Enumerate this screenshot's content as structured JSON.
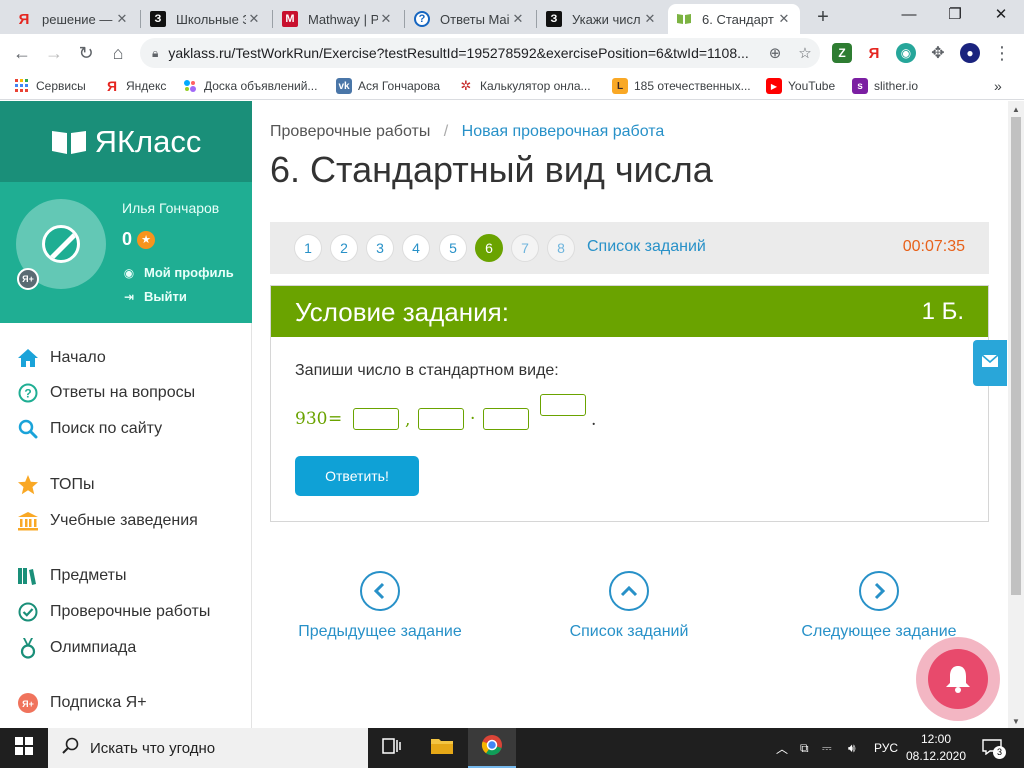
{
  "browser": {
    "tabs": [
      {
        "label": "решение —",
        "favicon": "yandex-icon",
        "active": false
      },
      {
        "label": "Школьные З",
        "favicon": "znanija-icon",
        "active": false
      },
      {
        "label": "Mathway | Pr",
        "favicon": "mathway-icon",
        "active": false
      },
      {
        "label": "Ответы Mail",
        "favicon": "question-icon",
        "active": false
      },
      {
        "label": "Укажи числ",
        "favicon": "znanija-icon",
        "active": false
      },
      {
        "label": "6. Стандарт",
        "favicon": "yaklass-icon",
        "active": true
      }
    ],
    "url": "yaklass.ru/TestWorkRun/Exercise?testResultId=195278592&exercisePosition=6&twId=1108...",
    "bookmarks": [
      {
        "label": "Сервисы",
        "icon": "apps-icon"
      },
      {
        "label": "Яндекс",
        "icon": "yandex-icon"
      },
      {
        "label": "Доска объявлений...",
        "icon": "avito-icon"
      },
      {
        "label": "Ася Гончарова",
        "icon": "vk-icon"
      },
      {
        "label": "Калькулятор онла...",
        "icon": "calculator-icon"
      },
      {
        "label": "185 отечественных...",
        "icon": "lit-icon"
      },
      {
        "label": "YouTube",
        "icon": "youtube-icon"
      },
      {
        "label": "slither.io",
        "icon": "slither-icon"
      }
    ],
    "bookmarks_more": "»"
  },
  "sidebar": {
    "logo": "ЯКласс",
    "user": {
      "name": "Илья Гончаров",
      "points": "0",
      "profile_link": "Мой профиль",
      "logout_link": "Выйти",
      "badge": "Я+"
    },
    "menu": [
      {
        "label": "Начало",
        "icon": "home-icon"
      },
      {
        "label": "Ответы на вопросы",
        "icon": "question-circle-icon"
      },
      {
        "label": "Поиск по сайту",
        "icon": "search-icon"
      },
      {
        "label": "ТОПы",
        "icon": "star-icon"
      },
      {
        "label": "Учебные заведения",
        "icon": "institution-icon"
      },
      {
        "label": "Предметы",
        "icon": "books-icon"
      },
      {
        "label": "Проверочные работы",
        "icon": "check-circle-icon"
      },
      {
        "label": "Олимпиада",
        "icon": "medal-icon"
      },
      {
        "label": "Подписка Я+",
        "icon": "subscription-icon"
      }
    ]
  },
  "main": {
    "breadcrumb": {
      "root": "Проверочные работы",
      "separator": "/",
      "current": "Новая проверочная работа"
    },
    "title": "6. Стандартный вид числа",
    "questions": [
      "1",
      "2",
      "3",
      "4",
      "5",
      "6",
      "7",
      "8"
    ],
    "current_question": "6",
    "task_list_link": "Список заданий",
    "timer": "00:07:35",
    "task": {
      "heading": "Условие задания:",
      "points": "1 Б.",
      "prompt": "Запиши число в стандартном виде:",
      "number": "930",
      "equals": "=",
      "comma": ",",
      "dot": "·",
      "period": ".",
      "submit": "Ответить!"
    },
    "pager": {
      "prev": "Предыдущее задание",
      "list": "Список заданий",
      "next": "Следующее задание"
    }
  },
  "taskbar": {
    "search_placeholder": "Искать что угодно",
    "language": "РУС",
    "time": "12:00",
    "date": "08.12.2020",
    "notifications": "3"
  },
  "colors": {
    "brand_dark": "#1a8f79",
    "brand": "#1fae93",
    "task_green": "#6aa300",
    "link_blue": "#2891c8",
    "timer_orange": "#e8611a",
    "button_blue": "#0fa1d6",
    "bell_pink": "#e84a6c"
  }
}
